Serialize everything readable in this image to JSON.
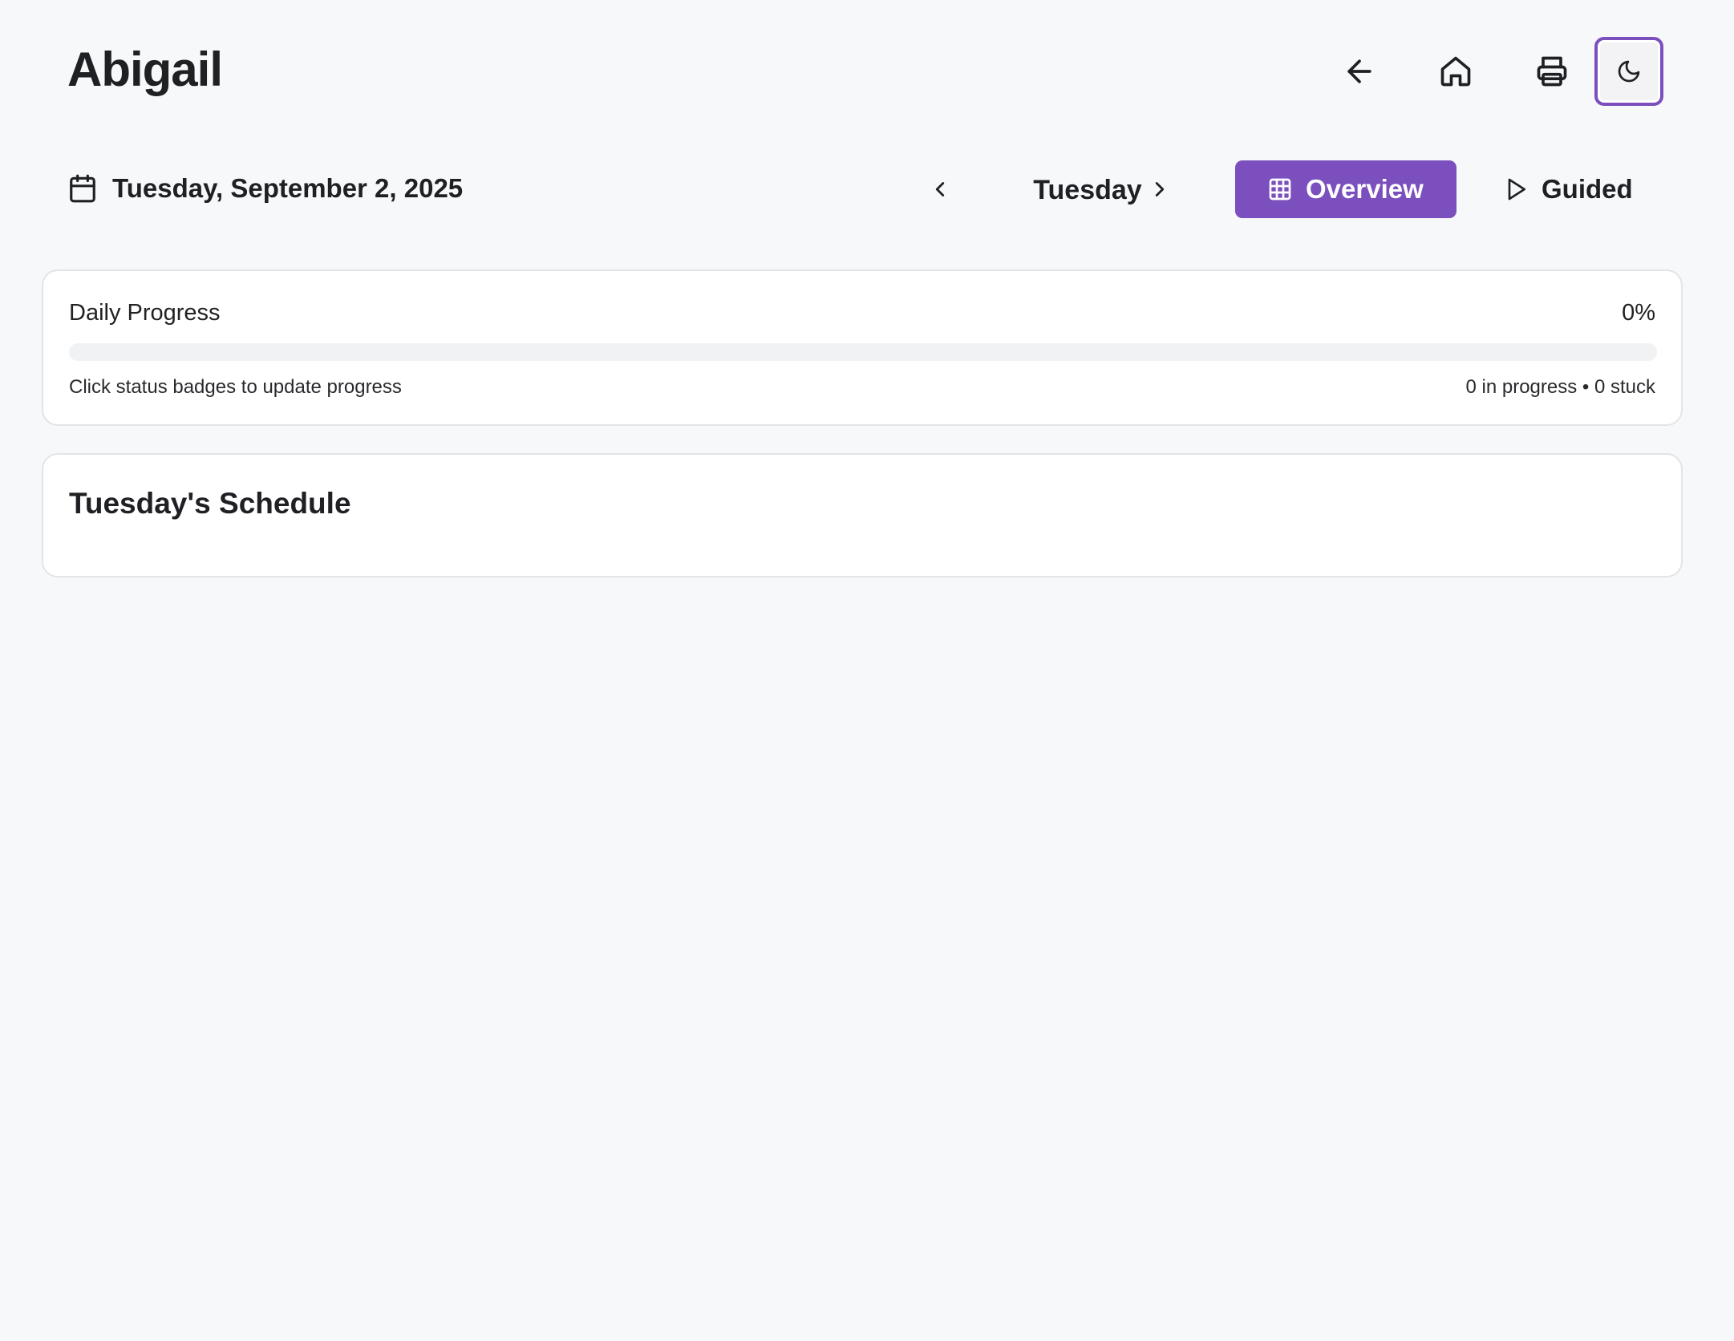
{
  "header": {
    "title": "Abigail",
    "icons": {
      "back": "arrow-left-icon",
      "home": "home-icon",
      "print": "printer-icon",
      "theme": "moon-icon"
    }
  },
  "date_bar": {
    "full_date": "Tuesday, September 2, 2025",
    "calendar_icon": "calendar-icon",
    "current_day": "Tuesday",
    "prev_icon": "chevron-left-icon",
    "next_icon": "chevron-right-icon"
  },
  "view_modes": [
    {
      "label": "Overview",
      "icon": "grid-icon",
      "active": true
    },
    {
      "label": "Guided",
      "icon": "play-icon",
      "active": false
    }
  ],
  "progress": {
    "label": "Daily Progress",
    "percent_text": "0%",
    "percent_value": 0,
    "hint": "Click status badges to update progress",
    "stats": "0 in progress • 0 stuck"
  },
  "schedule": {
    "title": "Tuesday's Schedule"
  },
  "colors": {
    "accent": "#7b4fbd",
    "background": "#f7f8fa",
    "card": "#ffffff",
    "track": "#f1f2f4"
  }
}
